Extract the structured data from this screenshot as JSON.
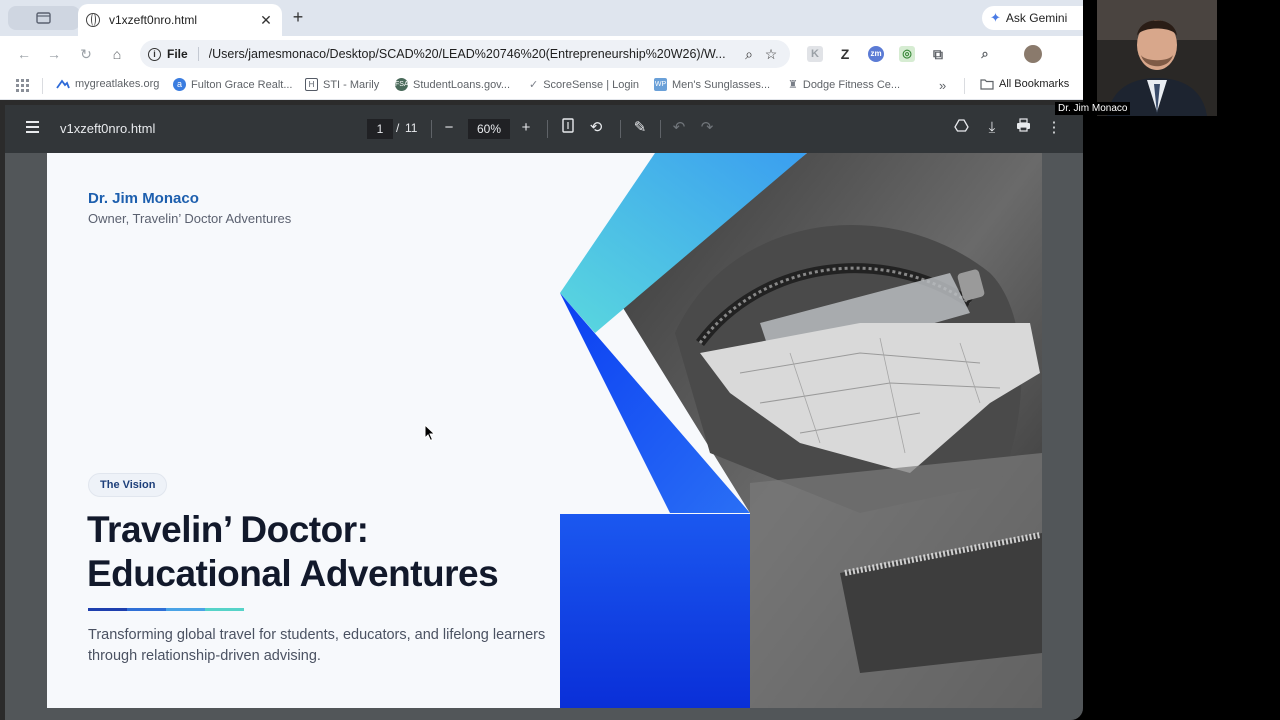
{
  "browser": {
    "tab_title": "v1xzeft0nro.html",
    "new_tab_glyph": "+",
    "ask_gemini": "Ask Gemini",
    "omnibox": {
      "scheme_label": "File",
      "url": "/Users/jamesmonaco/Desktop/SCAD%20/LEAD%20746%20(Entrepreneurship%20W26)/W..."
    },
    "bookmarks": [
      {
        "label": "mygreatlakes.org",
        "icon": "mountain-icon",
        "color": "#2e6ad8"
      },
      {
        "label": "Fulton Grace Realt...",
        "icon": "fulton-grace-icon",
        "color": "#3b7de0"
      },
      {
        "label": "STI - Marily",
        "icon": "sti-icon",
        "color": "#555b66"
      },
      {
        "label": "StudentLoans.gov...",
        "icon": "studentloans-icon",
        "color": "#4a6a5a"
      },
      {
        "label": "ScoreSense | Login",
        "icon": "check-icon",
        "color": "#7a7f88"
      },
      {
        "label": "Men's Sunglasses...",
        "icon": "wp-icon",
        "color": "#6aa0d8"
      },
      {
        "label": "Dodge Fitness Ce...",
        "icon": "dodge-icon",
        "color": "#7a7f88"
      }
    ],
    "all_bookmarks": "All Bookmarks"
  },
  "pdf": {
    "file_name": "v1xzeft0nro.html",
    "current_page": "1",
    "page_separator": "/",
    "total_pages": "11",
    "zoom": "60%"
  },
  "slide": {
    "author": "Dr. Jim Monaco",
    "role": "Owner, Travelin’ Doctor Adventures",
    "pill": "The Vision",
    "headline_line1": "Travelin’ Doctor:",
    "headline_line2": "Educational Adventures",
    "subtitle": "Transforming global travel for students, educators, and lifelong learners through relationship-driven advising.",
    "underline_colors": [
      "#1e3fae",
      "#2f6fd6",
      "#4aa3e6",
      "#56d3c8"
    ],
    "accent_colors": {
      "blue": "#0b3ff2",
      "cyan": "#5ad8de",
      "sky": "#3aa0f0"
    }
  },
  "webcam": {
    "participant_name": "Dr. Jim Monaco"
  }
}
